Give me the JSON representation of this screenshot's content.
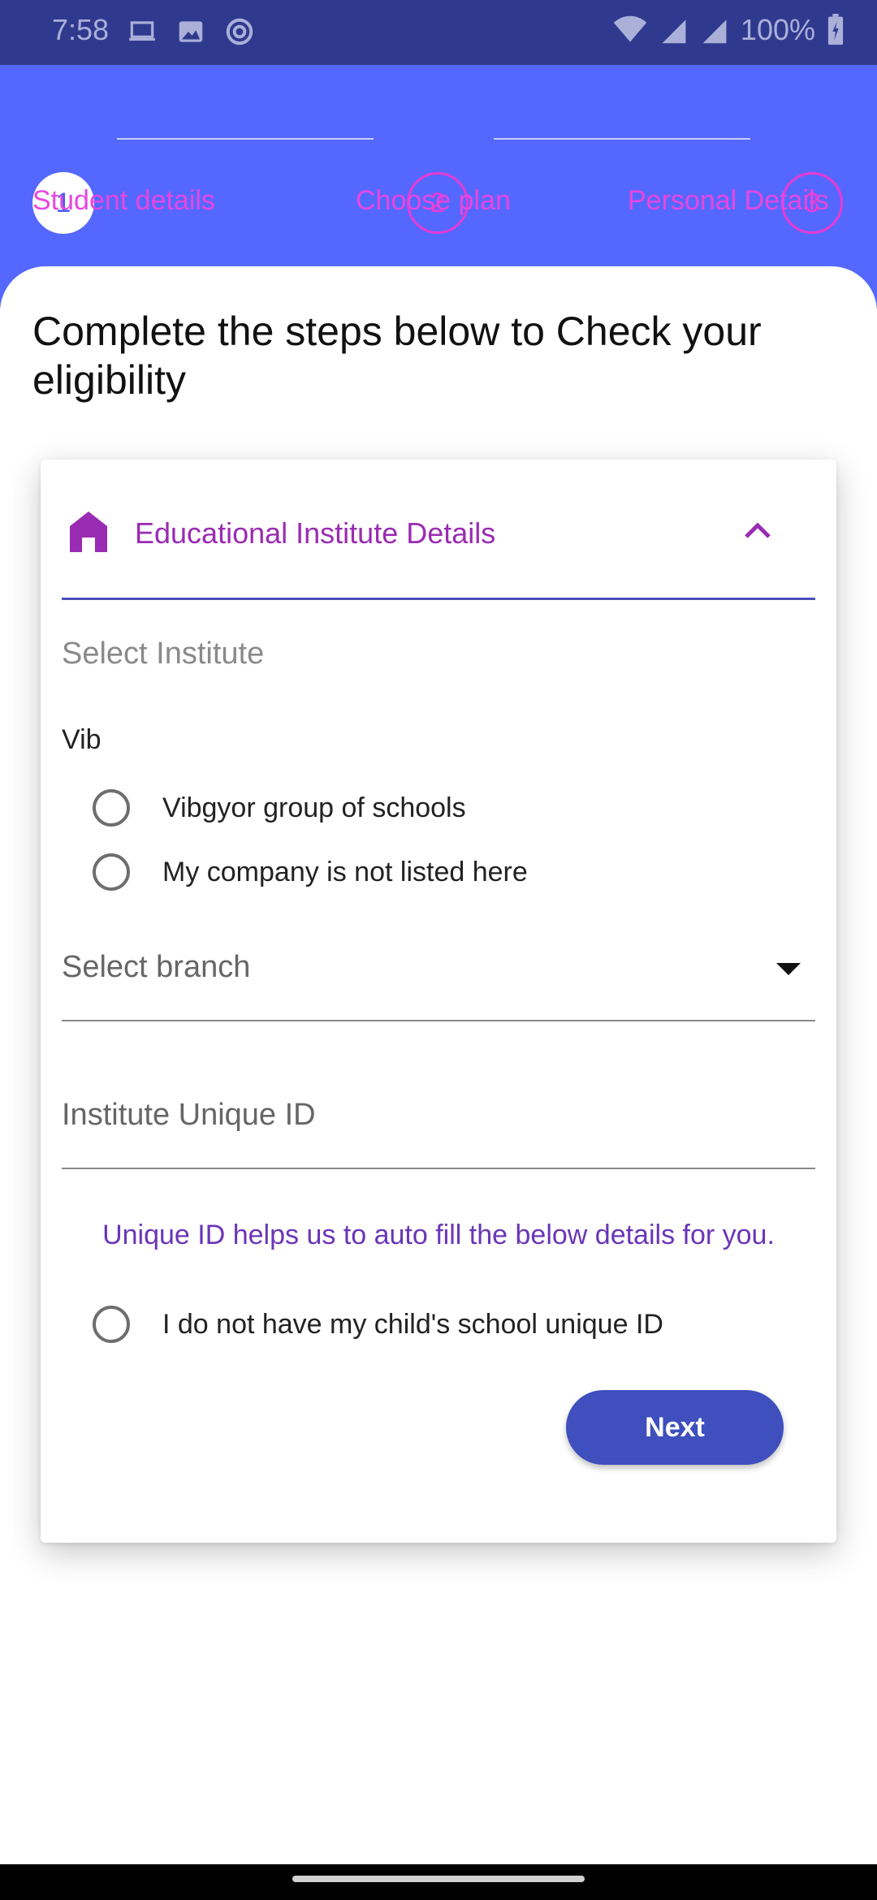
{
  "status_bar": {
    "time": "7:58",
    "battery": "100%",
    "icons": [
      "laptop-icon",
      "image-icon",
      "sync-icon",
      "wifi-icon",
      "signal-icon",
      "signal-icon",
      "battery-icon"
    ]
  },
  "stepper": {
    "steps": [
      {
        "number": "1",
        "label": "Student details",
        "active": true
      },
      {
        "number": "2",
        "label": "Choose plan",
        "active": false
      },
      {
        "number": "3",
        "label": "Personal Details",
        "active": false
      }
    ]
  },
  "headline": "Complete the steps below to Check your eligibility",
  "card": {
    "title": "Educational Institute Details",
    "select_institute_placeholder": "Select Institute",
    "search_text": "Vib",
    "institute_options": [
      "Vibgyor group of schools",
      "My company is not listed here"
    ],
    "branch_placeholder": "Select branch",
    "unique_id_placeholder": "Institute Unique ID",
    "helper_text": "Unique ID helps us to auto fill the below details for you.",
    "no_id_option": "I do not have my child's school unique ID",
    "next_label": "Next"
  },
  "colors": {
    "header_bg": "#5468ff",
    "status_bg": "#2f3a8f",
    "accent_purple": "#9a2bb3",
    "step_pink": "#e846df",
    "button_bg": "#3f4fbd",
    "helper_text": "#6a35b8"
  }
}
